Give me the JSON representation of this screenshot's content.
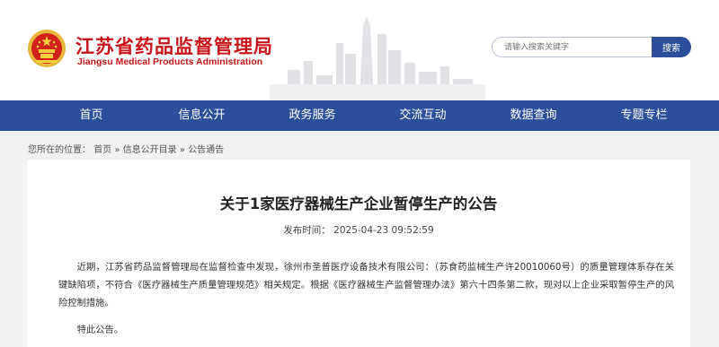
{
  "header": {
    "title": "江苏省药品监督管理局",
    "subtitle": "Jiangsu Medical Products Administration",
    "emblem_icon": "national-emblem-icon",
    "brand_color": "#c8141b"
  },
  "search": {
    "placeholder": "请输入搜索关键字",
    "button_label": "搜索"
  },
  "nav": {
    "color": "#2d4e9a",
    "items": [
      {
        "label": "首页"
      },
      {
        "label": "信息公开"
      },
      {
        "label": "政务服务"
      },
      {
        "label": "交流互动"
      },
      {
        "label": "数据查询"
      },
      {
        "label": "专题专栏"
      }
    ]
  },
  "breadcrumb": {
    "prefix": "您所在的位置：",
    "home": "首页",
    "sep1": "»",
    "catalog": "信息公开目录",
    "sep2": "»",
    "current": "公告通告"
  },
  "article": {
    "title": "关于1家医疗器械生产企业暂停生产的公告",
    "meta": "发布时间：  2025-04-23 09:52:59",
    "body": "近期，江苏省药品监督管理局在监督检查中发现，徐州市圣普医疗设备技术有限公司：（苏食药监械生产许20010060号）的质量管理体系存在关键缺陷项，不符合《医疗器械生产质量管理规范》相关规定。根据《医疗器械生产监督管理办法》第六十四条第二款，现对以上企业采取暂停生产的风险控制措施。",
    "closing": "特此公告。"
  }
}
